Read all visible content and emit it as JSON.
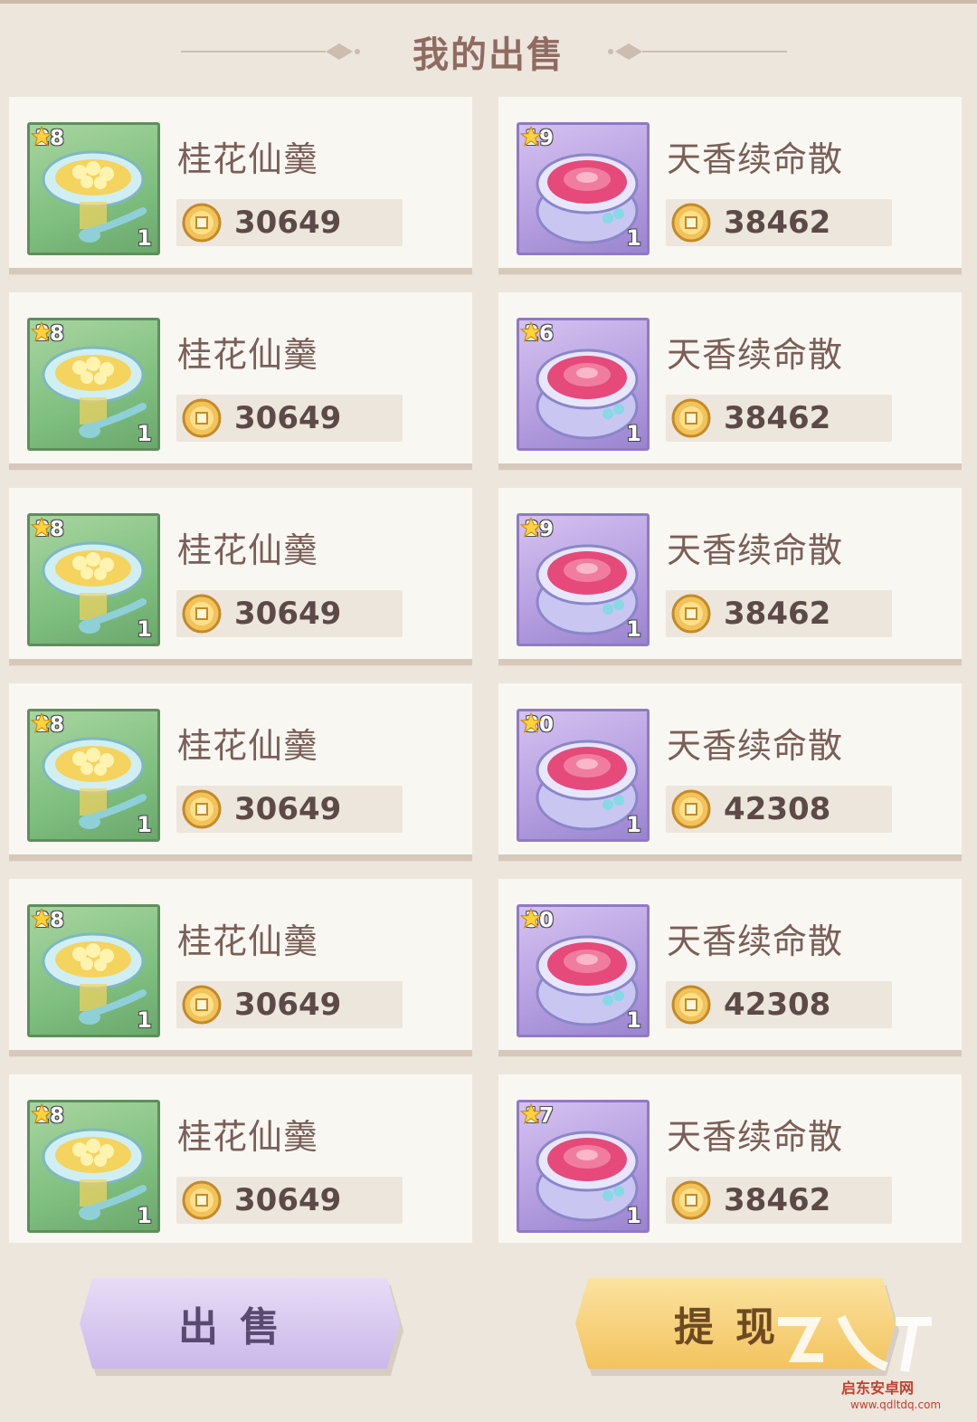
{
  "header": {
    "title": "我的出售"
  },
  "items": [
    {
      "name": "桂花仙羹",
      "level": "28",
      "qty": "1",
      "price": "30649",
      "color": "green"
    },
    {
      "name": "天香续命散",
      "level": "19",
      "qty": "1",
      "price": "38462",
      "color": "purple"
    },
    {
      "name": "桂花仙羹",
      "level": "28",
      "qty": "1",
      "price": "30649",
      "color": "green"
    },
    {
      "name": "天香续命散",
      "level": "26",
      "qty": "1",
      "price": "38462",
      "color": "purple"
    },
    {
      "name": "桂花仙羹",
      "level": "28",
      "qty": "1",
      "price": "30649",
      "color": "green"
    },
    {
      "name": "天香续命散",
      "level": "29",
      "qty": "1",
      "price": "38462",
      "color": "purple"
    },
    {
      "name": "桂花仙羹",
      "level": "28",
      "qty": "1",
      "price": "30649",
      "color": "green"
    },
    {
      "name": "天香续命散",
      "level": "30",
      "qty": "1",
      "price": "42308",
      "color": "purple"
    },
    {
      "name": "桂花仙羹",
      "level": "28",
      "qty": "1",
      "price": "30649",
      "color": "green"
    },
    {
      "name": "天香续命散",
      "level": "30",
      "qty": "1",
      "price": "42308",
      "color": "purple"
    },
    {
      "name": "桂花仙羹",
      "level": "28",
      "qty": "1",
      "price": "30649",
      "color": "green"
    },
    {
      "name": "天香续命散",
      "level": "17",
      "qty": "1",
      "price": "38462",
      "color": "purple"
    }
  ],
  "buttons": {
    "sell": "出售",
    "withdraw": "提现"
  },
  "watermark": {
    "text": "启东安卓网",
    "url": "www.qdltdq.com"
  },
  "colors": {
    "green_frame": "#7fbf7f",
    "purple_frame": "#b39ddf",
    "sell_button": "#cbb8ea",
    "withdraw_button": "#f3c35e"
  }
}
